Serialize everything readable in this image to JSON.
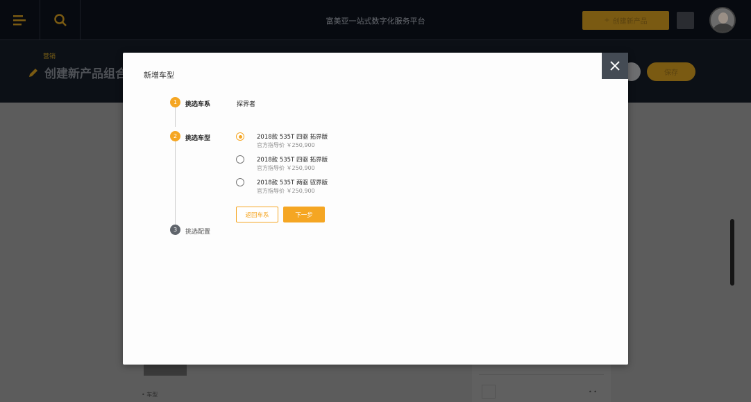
{
  "app": {
    "title": "富美亚一站式数字化服务平台",
    "create_button_label": "创建新产品",
    "breadcrumb": "营销",
    "page_title": "创建新产品组合",
    "pill_button_label": "保存",
    "bg_label": "• 车型",
    "bg_dots": "• •"
  },
  "modal": {
    "title": "新增车型",
    "steps": [
      {
        "number": "1",
        "label": "挑选车系",
        "state": "done"
      },
      {
        "number": "2",
        "label": "挑选车型",
        "state": "active"
      },
      {
        "number": "3",
        "label": "挑选配置",
        "state": "pending"
      }
    ],
    "selected_series": "探界者",
    "options": [
      {
        "name": "2018款 535T 四驱 拓界版",
        "price": "官方指导价  ￥250,900",
        "checked": true
      },
      {
        "name": "2018款 535T 四驱 拓界版",
        "price": "官方指导价  ￥250,900",
        "checked": false
      },
      {
        "name": "2018款 535T 两驱 驭界版",
        "price": "官方指导价  ￥250,900",
        "checked": false
      }
    ],
    "back_button_label": "返回车系",
    "next_button_label": "下一步"
  },
  "colors": {
    "accent": "#f5a623",
    "close_bg": "#444b54",
    "topbar_bg": "#070a10"
  }
}
